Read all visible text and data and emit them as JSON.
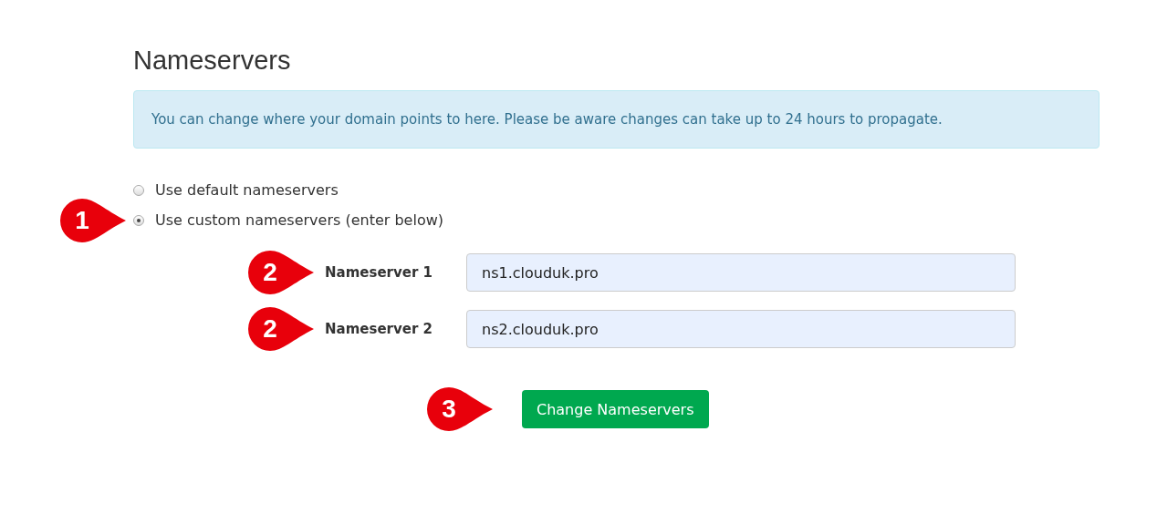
{
  "heading": "Nameservers",
  "notice": "You can change where your domain points to here. Please be aware changes can take up to 24 hours to propagate.",
  "options": [
    {
      "label": "Use default nameservers",
      "selected": false
    },
    {
      "label": "Use custom nameservers (enter below)",
      "selected": true,
      "marker": "1"
    }
  ],
  "fields": [
    {
      "label": "Nameserver 1",
      "value": "ns1.clouduk.pro",
      "marker": "2"
    },
    {
      "label": "Nameserver 2",
      "value": "ns2.clouduk.pro",
      "marker": "2"
    }
  ],
  "submit": {
    "label": "Change Nameservers",
    "marker": "3"
  }
}
